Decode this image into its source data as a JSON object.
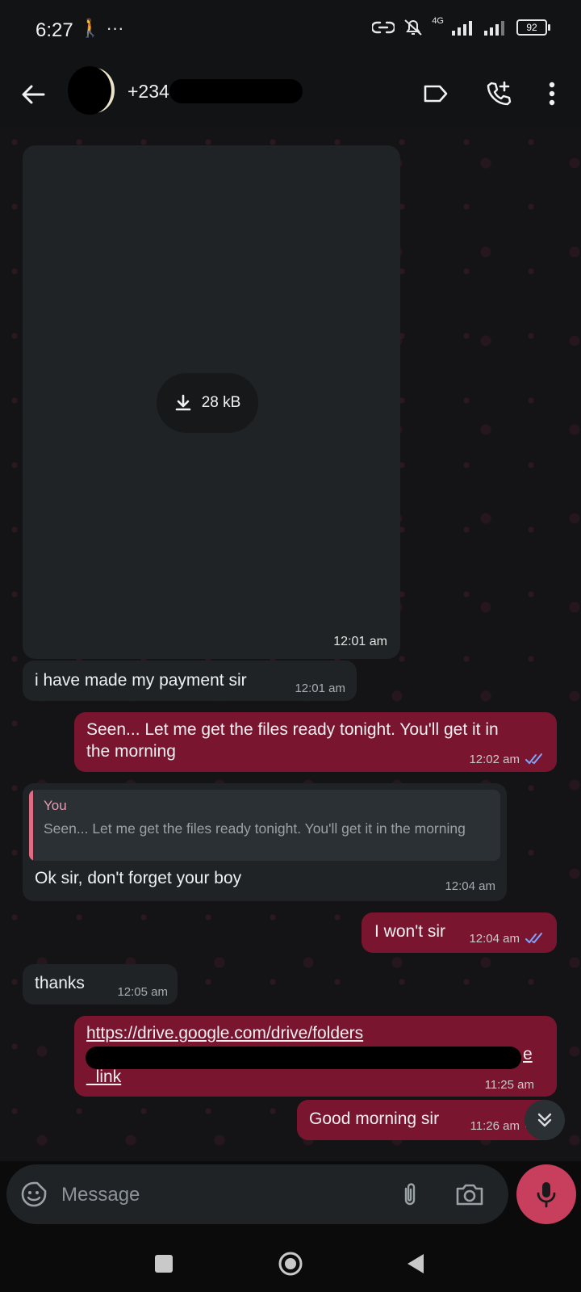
{
  "status_bar": {
    "time": "6:27",
    "activity_glyphs": "🚶 ···",
    "network": "4G",
    "battery": "92"
  },
  "header": {
    "contact_name": "+234"
  },
  "messages": {
    "image": {
      "download_size": "28 kB",
      "time": "12:01 am"
    },
    "m1": {
      "text": "i have made my payment sir",
      "time": "12:01 am"
    },
    "m2": {
      "text_line1": "Seen... Let me get the files ready tonight. You'll get it in",
      "text_line2": "the morning",
      "time": "12:02 am"
    },
    "m3": {
      "quote_author": "You",
      "quote_text": "Seen... Let me get the files ready tonight. You'll get it in the morning",
      "text": "Ok sir, don't forget your boy",
      "time": "12:04 am"
    },
    "m4": {
      "text": "I won't sir",
      "time": "12:04 am"
    },
    "m5": {
      "text": "thanks",
      "time": "12:05 am"
    },
    "m6": {
      "link_line1": "https://drive.google.com/drive/folders",
      "link_tail": "e",
      "link_line3": "_link",
      "time": "11:25 am"
    },
    "m7": {
      "text": "Good morning sir",
      "time": "11:26 am"
    }
  },
  "composer": {
    "placeholder": "Message"
  },
  "colors": {
    "outgoing_bubble": "#7a1530",
    "incoming_bubble": "#1f2326",
    "mic_button": "#c83e5d",
    "read_ticks": "#7ea6ff"
  },
  "icons": {
    "back": "arrow-left-icon",
    "label": "label-tag-icon",
    "call": "add-call-icon",
    "menu": "more-vertical-icon",
    "download": "download-icon",
    "scroll": "double-chevron-down-icon",
    "emoji": "sticker-emoji-icon",
    "attach": "paperclip-icon",
    "camera": "camera-icon",
    "mic": "microphone-icon"
  }
}
